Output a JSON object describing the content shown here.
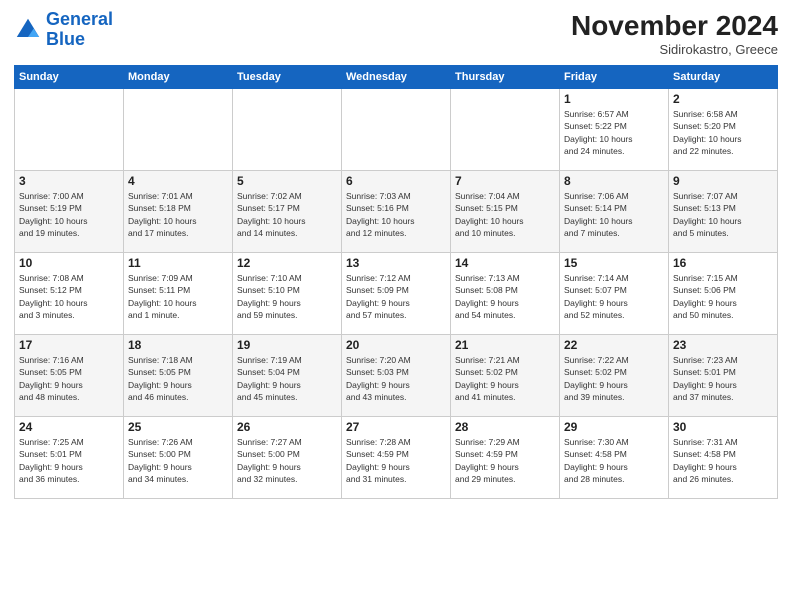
{
  "header": {
    "logo_line1": "General",
    "logo_line2": "Blue",
    "month": "November 2024",
    "location": "Sidirokastro, Greece"
  },
  "weekdays": [
    "Sunday",
    "Monday",
    "Tuesday",
    "Wednesday",
    "Thursday",
    "Friday",
    "Saturday"
  ],
  "weeks": [
    [
      {
        "day": "",
        "info": ""
      },
      {
        "day": "",
        "info": ""
      },
      {
        "day": "",
        "info": ""
      },
      {
        "day": "",
        "info": ""
      },
      {
        "day": "",
        "info": ""
      },
      {
        "day": "1",
        "info": "Sunrise: 6:57 AM\nSunset: 5:22 PM\nDaylight: 10 hours\nand 24 minutes."
      },
      {
        "day": "2",
        "info": "Sunrise: 6:58 AM\nSunset: 5:20 PM\nDaylight: 10 hours\nand 22 minutes."
      }
    ],
    [
      {
        "day": "3",
        "info": "Sunrise: 7:00 AM\nSunset: 5:19 PM\nDaylight: 10 hours\nand 19 minutes."
      },
      {
        "day": "4",
        "info": "Sunrise: 7:01 AM\nSunset: 5:18 PM\nDaylight: 10 hours\nand 17 minutes."
      },
      {
        "day": "5",
        "info": "Sunrise: 7:02 AM\nSunset: 5:17 PM\nDaylight: 10 hours\nand 14 minutes."
      },
      {
        "day": "6",
        "info": "Sunrise: 7:03 AM\nSunset: 5:16 PM\nDaylight: 10 hours\nand 12 minutes."
      },
      {
        "day": "7",
        "info": "Sunrise: 7:04 AM\nSunset: 5:15 PM\nDaylight: 10 hours\nand 10 minutes."
      },
      {
        "day": "8",
        "info": "Sunrise: 7:06 AM\nSunset: 5:14 PM\nDaylight: 10 hours\nand 7 minutes."
      },
      {
        "day": "9",
        "info": "Sunrise: 7:07 AM\nSunset: 5:13 PM\nDaylight: 10 hours\nand 5 minutes."
      }
    ],
    [
      {
        "day": "10",
        "info": "Sunrise: 7:08 AM\nSunset: 5:12 PM\nDaylight: 10 hours\nand 3 minutes."
      },
      {
        "day": "11",
        "info": "Sunrise: 7:09 AM\nSunset: 5:11 PM\nDaylight: 10 hours\nand 1 minute."
      },
      {
        "day": "12",
        "info": "Sunrise: 7:10 AM\nSunset: 5:10 PM\nDaylight: 9 hours\nand 59 minutes."
      },
      {
        "day": "13",
        "info": "Sunrise: 7:12 AM\nSunset: 5:09 PM\nDaylight: 9 hours\nand 57 minutes."
      },
      {
        "day": "14",
        "info": "Sunrise: 7:13 AM\nSunset: 5:08 PM\nDaylight: 9 hours\nand 54 minutes."
      },
      {
        "day": "15",
        "info": "Sunrise: 7:14 AM\nSunset: 5:07 PM\nDaylight: 9 hours\nand 52 minutes."
      },
      {
        "day": "16",
        "info": "Sunrise: 7:15 AM\nSunset: 5:06 PM\nDaylight: 9 hours\nand 50 minutes."
      }
    ],
    [
      {
        "day": "17",
        "info": "Sunrise: 7:16 AM\nSunset: 5:05 PM\nDaylight: 9 hours\nand 48 minutes."
      },
      {
        "day": "18",
        "info": "Sunrise: 7:18 AM\nSunset: 5:05 PM\nDaylight: 9 hours\nand 46 minutes."
      },
      {
        "day": "19",
        "info": "Sunrise: 7:19 AM\nSunset: 5:04 PM\nDaylight: 9 hours\nand 45 minutes."
      },
      {
        "day": "20",
        "info": "Sunrise: 7:20 AM\nSunset: 5:03 PM\nDaylight: 9 hours\nand 43 minutes."
      },
      {
        "day": "21",
        "info": "Sunrise: 7:21 AM\nSunset: 5:02 PM\nDaylight: 9 hours\nand 41 minutes."
      },
      {
        "day": "22",
        "info": "Sunrise: 7:22 AM\nSunset: 5:02 PM\nDaylight: 9 hours\nand 39 minutes."
      },
      {
        "day": "23",
        "info": "Sunrise: 7:23 AM\nSunset: 5:01 PM\nDaylight: 9 hours\nand 37 minutes."
      }
    ],
    [
      {
        "day": "24",
        "info": "Sunrise: 7:25 AM\nSunset: 5:01 PM\nDaylight: 9 hours\nand 36 minutes."
      },
      {
        "day": "25",
        "info": "Sunrise: 7:26 AM\nSunset: 5:00 PM\nDaylight: 9 hours\nand 34 minutes."
      },
      {
        "day": "26",
        "info": "Sunrise: 7:27 AM\nSunset: 5:00 PM\nDaylight: 9 hours\nand 32 minutes."
      },
      {
        "day": "27",
        "info": "Sunrise: 7:28 AM\nSunset: 4:59 PM\nDaylight: 9 hours\nand 31 minutes."
      },
      {
        "day": "28",
        "info": "Sunrise: 7:29 AM\nSunset: 4:59 PM\nDaylight: 9 hours\nand 29 minutes."
      },
      {
        "day": "29",
        "info": "Sunrise: 7:30 AM\nSunset: 4:58 PM\nDaylight: 9 hours\nand 28 minutes."
      },
      {
        "day": "30",
        "info": "Sunrise: 7:31 AM\nSunset: 4:58 PM\nDaylight: 9 hours\nand 26 minutes."
      }
    ]
  ]
}
